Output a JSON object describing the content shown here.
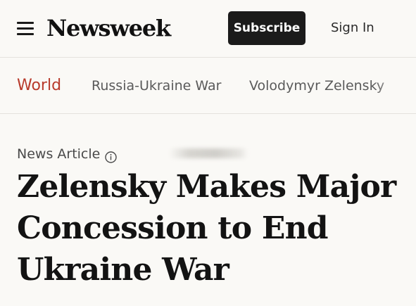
{
  "header": {
    "logo": "Newsweek",
    "subscribe_label": "Subscribe",
    "signin_label": "Sign In"
  },
  "nav": {
    "items": [
      {
        "label": "World",
        "active": true
      },
      {
        "label": "Russia-Ukraine War",
        "active": false
      },
      {
        "label": "Volodymyr Zelensky",
        "active": false
      }
    ]
  },
  "article": {
    "type": "News Article",
    "headline": "Zelensky Makes Major Concession to End Ukraine War"
  },
  "colors": {
    "background": "#faf9f6",
    "accent": "#b83a2b",
    "button_bg": "#1b1b1b"
  }
}
